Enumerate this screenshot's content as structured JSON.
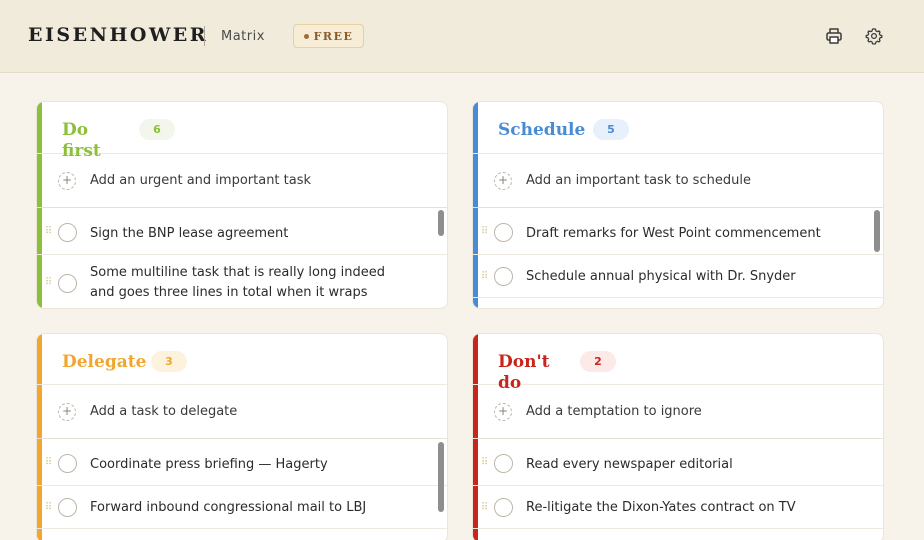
{
  "header": {
    "brand": "EISENHOWER",
    "subtitle": "Matrix",
    "badge": "FREE",
    "icons": [
      "printer-icon",
      "gear-icon"
    ]
  },
  "colors": {
    "do_first": "#8cbf3a",
    "schedule": "#4a8bd6",
    "delegate": "#f0a62f",
    "dont_do": "#c8251c"
  },
  "quadrants": {
    "do_first": {
      "title": "Do first",
      "count": "6",
      "add_text": "Add an urgent and important task",
      "tasks": [
        "Sign the BNP lease agreement",
        "Some multiline task that is really long indeed and goes three lines in total when it wraps"
      ]
    },
    "schedule": {
      "title": "Schedule",
      "count": "5",
      "add_text": "Add an important task to schedule",
      "tasks": [
        "Draft remarks for West Point commencement",
        "Schedule annual physical with Dr. Snyder"
      ]
    },
    "delegate": {
      "title": "Delegate",
      "count": "3",
      "add_text": "Add a task to delegate",
      "tasks": [
        "Coordinate press briefing — Hagerty",
        "Forward inbound congressional mail to LBJ"
      ]
    },
    "dont_do": {
      "title": "Don't do",
      "count": "2",
      "add_text": "Add a temptation to ignore",
      "tasks": [
        "Read every newspaper editorial",
        "Re-litigate the Dixon-Yates contract on TV"
      ]
    }
  }
}
